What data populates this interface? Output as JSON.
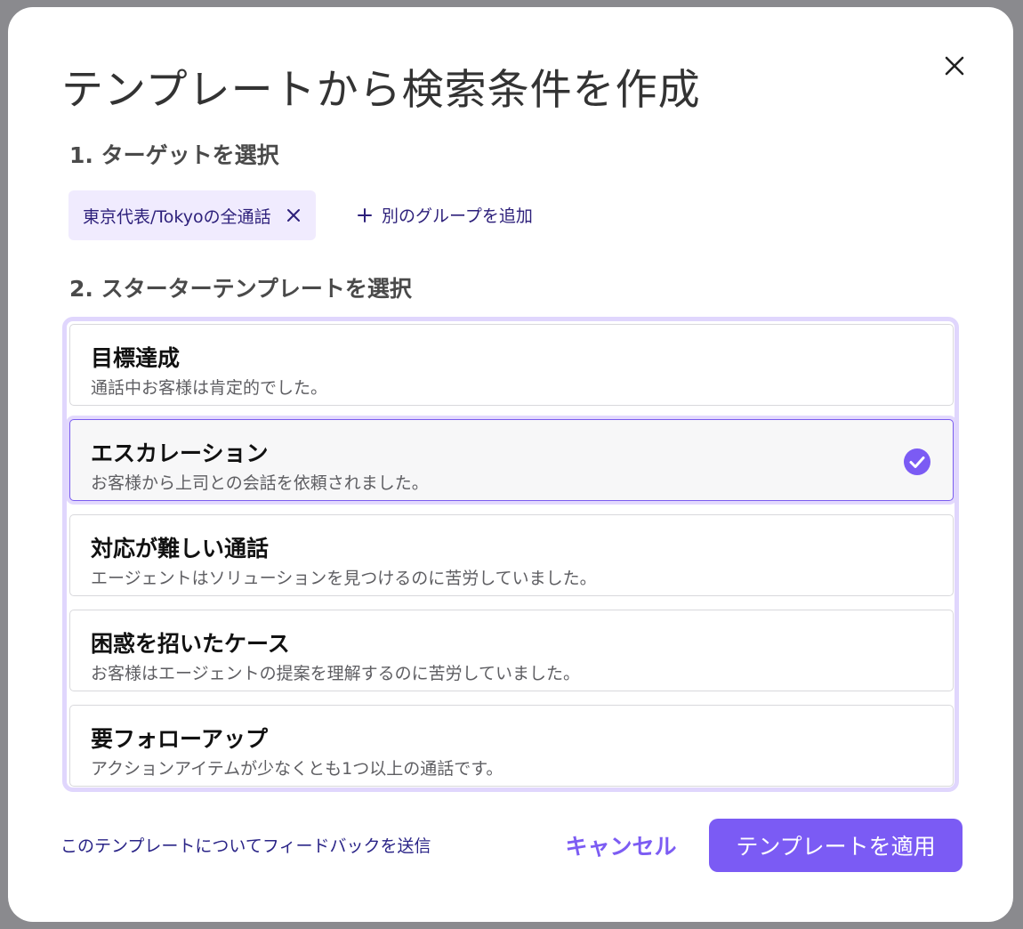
{
  "dialog": {
    "title": "テンプレートから検索条件を作成",
    "close_icon": "close-icon"
  },
  "step1": {
    "heading": "1. ターゲットを選択",
    "chips": [
      {
        "label": "東京代表/Tokyoの全通話",
        "remove_icon": "close-icon"
      }
    ],
    "add_group_label": "別のグループを追加",
    "add_group_icon": "plus-icon"
  },
  "step2": {
    "heading": "2. スターターテンプレートを選択",
    "templates": [
      {
        "title": "目標達成",
        "description": "通話中お客様は肯定的でした。",
        "selected": false
      },
      {
        "title": "エスカレーション",
        "description": "お客様から上司との会話を依頼されました。",
        "selected": true
      },
      {
        "title": "対応が難しい通話",
        "description": "エージェントはソリューションを見つけるのに苦労していました。",
        "selected": false
      },
      {
        "title": "困惑を招いたケース",
        "description": "お客様はエージェントの提案を理解するのに苦労していました。",
        "selected": false
      },
      {
        "title": "要フォローアップ",
        "description": "アクションアイテムが少なくとも1つ以上の通話です。",
        "selected": false
      }
    ],
    "selected_icon": "check-circle-icon"
  },
  "footer": {
    "feedback_link": "このテンプレートについてフィードバックを送信",
    "cancel_label": "キャンセル",
    "apply_label": "テンプレートを適用"
  },
  "colors": {
    "accent": "#7b5bf4",
    "chip_bg": "#f0ebfe",
    "selected_ring": "#e3d9fd",
    "link": "#2a2487"
  }
}
